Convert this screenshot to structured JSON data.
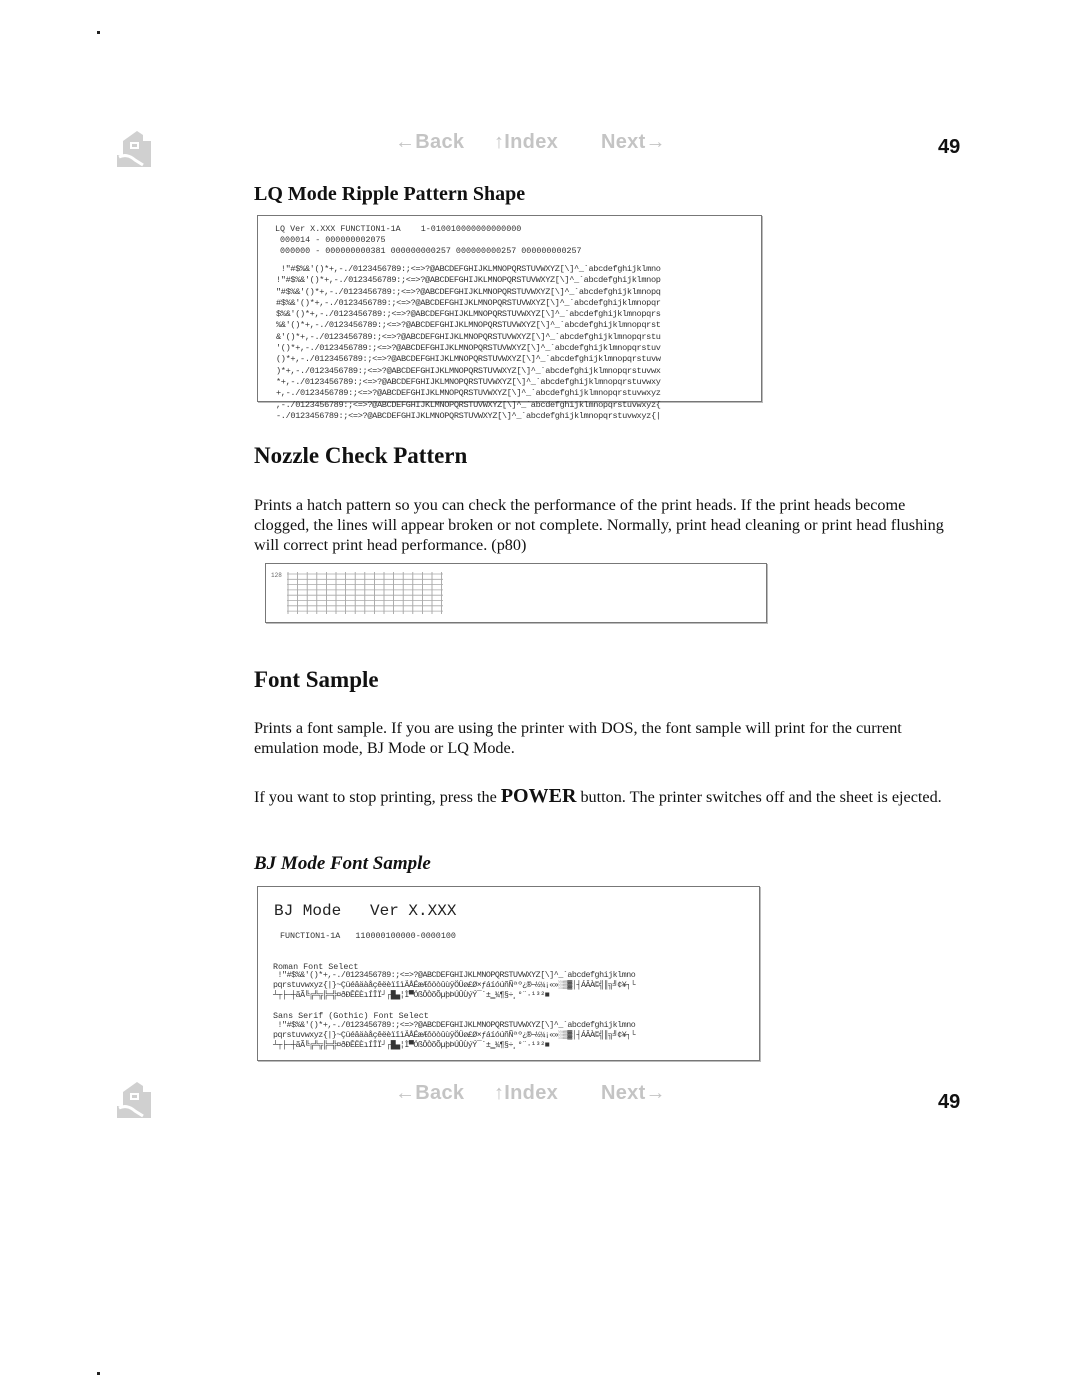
{
  "page": {
    "number": "49"
  },
  "nav": {
    "back": "←Back",
    "index": "↑Index",
    "next": "Next→"
  },
  "sections": {
    "lq_ripple": {
      "title": "LQ Mode Ripple Pattern Shape",
      "sample": {
        "header": [
          "LQ Ver X.XXX FUNCTION1-1A    1-010010000000000000",
          " 000014 - 000000002075",
          " 000000 - 000000000381 000000000257 000000000257 000000000257"
        ],
        "rows": [
          " !\"#$%&'()*+,-./0123456789:;<=>?@ABCDEFGHIJKLMNOPQRSTUVWXYZ[\\]^_`abcdefghijklmno",
          "!\"#$%&'()*+,-./0123456789:;<=>?@ABCDEFGHIJKLMNOPQRSTUVWXYZ[\\]^_`abcdefghijklmnop",
          "\"#$%&'()*+,-./0123456789:;<=>?@ABCDEFGHIJKLMNOPQRSTUVWXYZ[\\]^_`abcdefghijklmnopq",
          "#$%&'()*+,-./0123456789:;<=>?@ABCDEFGHIJKLMNOPQRSTUVWXYZ[\\]^_`abcdefghijklmnopqr",
          "$%&'()*+,-./0123456789:;<=>?@ABCDEFGHIJKLMNOPQRSTUVWXYZ[\\]^_`abcdefghijklmnopqrs",
          "%&'()*+,-./0123456789:;<=>?@ABCDEFGHIJKLMNOPQRSTUVWXYZ[\\]^_`abcdefghijklmnopqrst",
          "&'()*+,-./0123456789:;<=>?@ABCDEFGHIJKLMNOPQRSTUVWXYZ[\\]^_`abcdefghijklmnopqrstu",
          "'()*+,-./0123456789:;<=>?@ABCDEFGHIJKLMNOPQRSTUVWXYZ[\\]^_`abcdefghijklmnopqrstuv",
          "()*+,-./0123456789:;<=>?@ABCDEFGHIJKLMNOPQRSTUVWXYZ[\\]^_`abcdefghijklmnopqrstuvw",
          ")*+,-./0123456789:;<=>?@ABCDEFGHIJKLMNOPQRSTUVWXYZ[\\]^_`abcdefghijklmnopqrstuvwx",
          "*+,-./0123456789:;<=>?@ABCDEFGHIJKLMNOPQRSTUVWXYZ[\\]^_`abcdefghijklmnopqrstuvwxy",
          "+,-./0123456789:;<=>?@ABCDEFGHIJKLMNOPQRSTUVWXYZ[\\]^_`abcdefghijklmnopqrstuvwxyz",
          ",-./0123456789:;<=>?@ABCDEFGHIJKLMNOPQRSTUVWXYZ[\\]^_`abcdefghijklmnopqrstuvwxyz{",
          "-./0123456789:;<=>?@ABCDEFGHIJKLMNOPQRSTUVWXYZ[\\]^_`abcdefghijklmnopqrstuvwxyz{|"
        ]
      }
    },
    "nozzle": {
      "title": "Nozzle Check Pattern",
      "body": "Prints a hatch pattern so you can check the performance of the print heads. If the print heads become clogged, the lines will appear broken or not complete. Normally, print head cleaning or print head flushing will correct print head performance. (p80)",
      "sample_label": "128"
    },
    "font_sample": {
      "title": "Font Sample",
      "body1": "Prints a font sample. If you are using the printer with DOS, the font sample will print for the current emulation mode, BJ Mode or LQ Mode.",
      "body2_pre": "If you want to stop printing, press the ",
      "body2_key": "POWER",
      "body2_post": " button. The printer switches off and the sheet is ejected.",
      "bj_title": "BJ Mode Font Sample",
      "bj_sample": {
        "title": "BJ Mode   Ver X.XXX",
        "func": "FUNCTION1-1A   110000100000-0000100",
        "roman_label": "Roman Font Select",
        "roman_lines": [
          " !\"#$%&'()*+,-./0123456789:;<=>?@ABCDEFGHIJKLMNOPQRSTUVWXYZ[\\]^_`abcdefghijklmno",
          "pqrstuvwxyz{|}~ÇüéâäàåçêëèïîìÄÅÉæÆôöòûùÿÖÜø£Ø×ƒáíóúñÑªº¿®¬½¼¡«»░▒▓│┤ÁÂÀ©╣║╗╝¢¥┐└",
          "┴┬├─┼ãÃ╚╔╩╦╠═╬¤ðÐÊËÈıÍÎÏ┘┌█▄¦Ì▀ÓßÔÒõÕµþÞÚÛÙýÝ¯´­±‗¾¶§÷¸°¨·¹³²■"
        ],
        "sans_label": "Sans Serif (Gothic) Font Select",
        "sans_lines": [
          " !\"#$%&'()*+,-./0123456789:;<=>?@ABCDEFGHIJKLMNOPQRSTUVWXYZ[\\]^_`abcdefghijklmno",
          "pqrstuvwxyz{|}~ÇüéâäàåçêëèïîìÄÅÉæÆôöòûùÿÖÜø£Ø×ƒáíóúñÑªº¿®¬½¼¡«»░▒▓│┤ÁÂÀ©╣║╗╝¢¥┐└",
          "┴┬├─┼ãÃ╚╔╩╦╠═╬¤ðÐÊËÈıÍÎÏ┘┌█▄¦Ì▀ÓßÔÒõÕµþÞÚÛÙýÝ¯´­±‗¾¶§÷¸°¨·¹³²■"
        ]
      }
    }
  },
  "colors": {
    "nav_inactive": "#c4c4c4",
    "text": "#111111"
  }
}
